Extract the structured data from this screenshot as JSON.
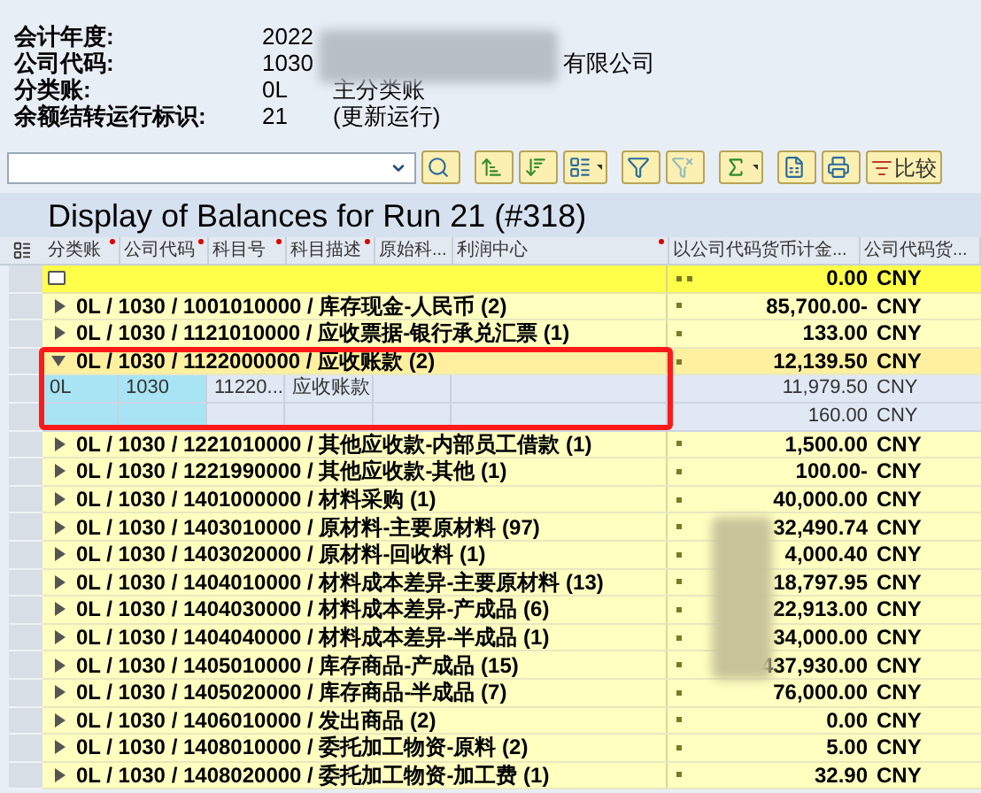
{
  "header_fields": [
    {
      "label": "会计年度:",
      "value": "2022"
    },
    {
      "label": "公司代码:",
      "value": "1030",
      "text": "有限公司"
    },
    {
      "label": "分类账:",
      "value": "0L",
      "text": "主分类账"
    },
    {
      "label": "余额结转运行标识:",
      "value": "21",
      "text": "(更新运行)"
    }
  ],
  "toolbar": {
    "compare_label": "比较"
  },
  "title": "Display of Balances for Run 21 (#318)",
  "columns": [
    {
      "label": "分类账",
      "marked": true
    },
    {
      "label": "公司代码",
      "marked": true
    },
    {
      "label": "科目号",
      "marked": true
    },
    {
      "label": "科目描述",
      "marked": true
    },
    {
      "label": "原始科...",
      "marked": false
    },
    {
      "label": "利润中心",
      "marked": true
    },
    {
      "label": "以公司代码货币计金...",
      "marked": false
    },
    {
      "label": "公司代码货...",
      "marked": false
    }
  ],
  "total_row": {
    "amount": "0.00",
    "currency": "CNY"
  },
  "rows": [
    {
      "kind": "group",
      "label": "0L / 1030 / 1001010000 / 库存现金-人民币 (2)",
      "expanded": false,
      "amount": "85,700.00-",
      "currency": "CNY"
    },
    {
      "kind": "group",
      "label": "0L / 1030 / 1121010000 / 应收票据-银行承兑汇票 (1)",
      "expanded": false,
      "amount": "133.00",
      "currency": "CNY"
    },
    {
      "kind": "group",
      "label": "0L / 1030 / 1122000000 / 应收账款 (2)",
      "expanded": true,
      "amount": "12,139.50",
      "currency": "CNY"
    },
    {
      "kind": "item",
      "cells": [
        "0L",
        "1030",
        "11220...",
        "应收账款",
        "",
        ""
      ],
      "amount": "11,979.50",
      "currency": "CNY"
    },
    {
      "kind": "item",
      "cells": [
        "",
        "",
        "",
        "",
        "",
        ""
      ],
      "amount": "160.00",
      "currency": "CNY"
    },
    {
      "kind": "group",
      "label": "0L / 1030 / 1221010000 / 其他应收款-内部员工借款 (1)",
      "expanded": false,
      "amount": "1,500.00",
      "currency": "CNY"
    },
    {
      "kind": "group",
      "label": "0L / 1030 / 1221990000 / 其他应收款-其他 (1)",
      "expanded": false,
      "amount": "100.00-",
      "currency": "CNY"
    },
    {
      "kind": "group",
      "label": "0L / 1030 / 1401000000 / 材料采购 (1)",
      "expanded": false,
      "amount": "40,000.00",
      "currency": "CNY"
    },
    {
      "kind": "group",
      "label": "0L / 1030 / 1403010000 / 原材料-主要原材料 (97)",
      "expanded": false,
      "amount": "32,490.74",
      "currency": "CNY"
    },
    {
      "kind": "group",
      "label": "0L / 1030 / 1403020000 / 原材料-回收料 (1)",
      "expanded": false,
      "amount": "4,000.40",
      "currency": "CNY"
    },
    {
      "kind": "group",
      "label": "0L / 1030 / 1404010000 / 材料成本差异-主要原材料 (13)",
      "expanded": false,
      "amount": "18,797.95",
      "currency": "CNY"
    },
    {
      "kind": "group",
      "label": "0L / 1030 / 1404030000 / 材料成本差异-产成品 (6)",
      "expanded": false,
      "amount": "22,913.00",
      "currency": "CNY"
    },
    {
      "kind": "group",
      "label": "0L / 1030 / 1404040000 / 材料成本差异-半成品 (1)",
      "expanded": false,
      "amount": "34,000.00",
      "currency": "CNY"
    },
    {
      "kind": "group",
      "label": "0L / 1030 / 1405010000 / 库存商品-产成品 (15)",
      "expanded": false,
      "amount": "437,930.00",
      "currency": "CNY"
    },
    {
      "kind": "group",
      "label": "0L / 1030 / 1405020000 / 库存商品-半成品 (7)",
      "expanded": false,
      "amount": "76,000.00",
      "currency": "CNY"
    },
    {
      "kind": "group",
      "label": "0L / 1030 / 1406010000 / 发出商品 (2)",
      "expanded": false,
      "amount": "0.00",
      "currency": "CNY"
    },
    {
      "kind": "group",
      "label": "0L / 1030 / 1408010000 / 委托加工物资-原料 (2)",
      "expanded": false,
      "amount": "5.00",
      "currency": "CNY"
    },
    {
      "kind": "group",
      "label": "0L / 1030 / 1408020000 / 委托加工物资-加工费 (1)",
      "expanded": false,
      "amount": "32.90",
      "currency": "CNY"
    }
  ]
}
